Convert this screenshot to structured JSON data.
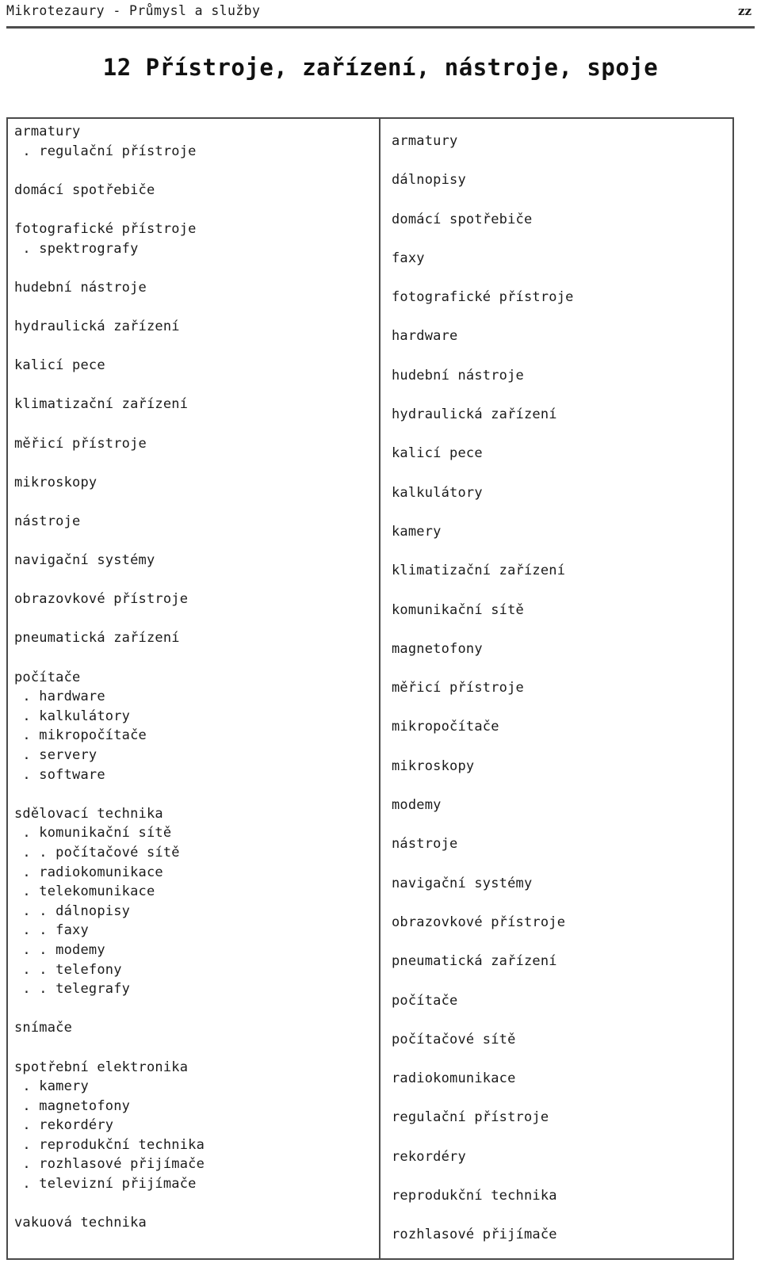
{
  "running_head": {
    "title": "Mikrotezaury - Průmysl a služby",
    "folio": "zz"
  },
  "page_title": "12  Přístroje, zařízení, nástroje, spoje",
  "left_column": {
    "entries": [
      {
        "text": "armatury",
        "level": 0,
        "gap_before": false
      },
      {
        "text": ". regulační přístroje",
        "level": 1,
        "gap_before": false
      },
      {
        "text": "domácí spotřebiče",
        "level": 0,
        "gap_before": true
      },
      {
        "text": "fotografické přístroje",
        "level": 0,
        "gap_before": true
      },
      {
        "text": ". spektrografy",
        "level": 1,
        "gap_before": false
      },
      {
        "text": "hudební nástroje",
        "level": 0,
        "gap_before": true
      },
      {
        "text": "hydraulická zařízení",
        "level": 0,
        "gap_before": true
      },
      {
        "text": "kalicí pece",
        "level": 0,
        "gap_before": true
      },
      {
        "text": "klimatizační zařízení",
        "level": 0,
        "gap_before": true
      },
      {
        "text": "měřicí přístroje",
        "level": 0,
        "gap_before": true
      },
      {
        "text": "mikroskopy",
        "level": 0,
        "gap_before": true
      },
      {
        "text": "nástroje",
        "level": 0,
        "gap_before": true
      },
      {
        "text": "navigační systémy",
        "level": 0,
        "gap_before": true
      },
      {
        "text": "obrazovkové přístroje",
        "level": 0,
        "gap_before": true
      },
      {
        "text": "pneumatická zařízení",
        "level": 0,
        "gap_before": true
      },
      {
        "text": "počítače",
        "level": 0,
        "gap_before": true
      },
      {
        "text": ". hardware",
        "level": 1,
        "gap_before": false
      },
      {
        "text": ". kalkulátory",
        "level": 1,
        "gap_before": false
      },
      {
        "text": ". mikropočítače",
        "level": 1,
        "gap_before": false
      },
      {
        "text": ". servery",
        "level": 1,
        "gap_before": false
      },
      {
        "text": ". software",
        "level": 1,
        "gap_before": false
      },
      {
        "text": "sdělovací technika",
        "level": 0,
        "gap_before": true
      },
      {
        "text": ". komunikační sítě",
        "level": 1,
        "gap_before": false
      },
      {
        "text": ". . počítačové sítě",
        "level": 2,
        "gap_before": false
      },
      {
        "text": ". radiokomunikace",
        "level": 1,
        "gap_before": false
      },
      {
        "text": ". telekomunikace",
        "level": 1,
        "gap_before": false
      },
      {
        "text": ". . dálnopisy",
        "level": 2,
        "gap_before": false
      },
      {
        "text": ". . faxy",
        "level": 2,
        "gap_before": false
      },
      {
        "text": ". . modemy",
        "level": 2,
        "gap_before": false
      },
      {
        "text": ". . telefony",
        "level": 2,
        "gap_before": false
      },
      {
        "text": ". . telegrafy",
        "level": 2,
        "gap_before": false
      },
      {
        "text": "snímače",
        "level": 0,
        "gap_before": true
      },
      {
        "text": "spotřební elektronika",
        "level": 0,
        "gap_before": true
      },
      {
        "text": ". kamery",
        "level": 1,
        "gap_before": false
      },
      {
        "text": ". magnetofony",
        "level": 1,
        "gap_before": false
      },
      {
        "text": ". rekordéry",
        "level": 1,
        "gap_before": false
      },
      {
        "text": ". reprodukční technika",
        "level": 1,
        "gap_before": false
      },
      {
        "text": ". rozhlasové přijímače",
        "level": 1,
        "gap_before": false
      },
      {
        "text": ". televizní přijímače",
        "level": 1,
        "gap_before": false
      },
      {
        "text": "vakuová technika",
        "level": 0,
        "gap_before": true
      }
    ]
  },
  "right_column": {
    "entries": [
      "armatury",
      "dálnopisy",
      "domácí spotřebiče",
      "faxy",
      "fotografické přístroje",
      "hardware",
      "hudební nástroje",
      "hydraulická zařízení",
      "kalicí pece",
      "kalkulátory",
      "kamery",
      "klimatizační zařízení",
      "komunikační sítě",
      "magnetofony",
      "měřicí přístroje",
      "mikropočítače",
      "mikroskopy",
      "modemy",
      "nástroje",
      "navigační systémy",
      "obrazovkové přístroje",
      "pneumatická zařízení",
      "počítače",
      "počítačové sítě",
      "radiokomunikace",
      "regulační přístroje",
      "rekordéry",
      "reprodukční technika",
      "rozhlasové přijímače"
    ]
  },
  "colors": {
    "text": "#1b1b1b",
    "rule": "#4d4d4d",
    "border": "#4a4a4a",
    "page_background": "#ffffff"
  }
}
